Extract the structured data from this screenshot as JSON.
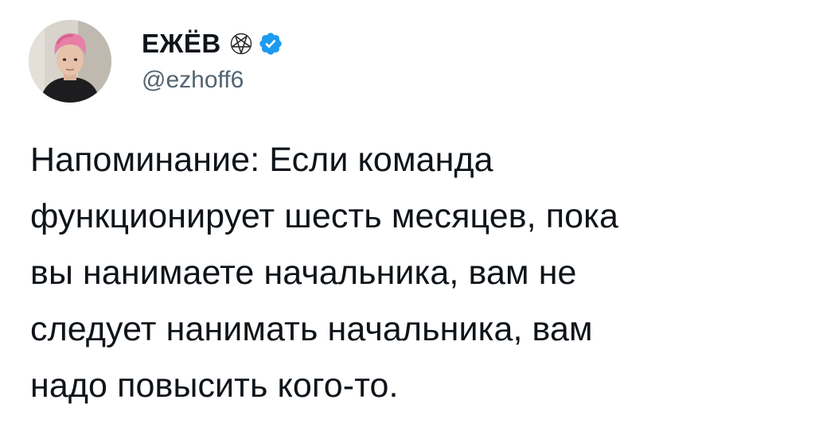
{
  "author": {
    "display_name": "ЕЖЁВ",
    "handle": "@ezhoff6",
    "badge_icon": "pentagram-icon",
    "verified_icon": "verified-badge-icon",
    "verified_color": "#1d9bf0",
    "avatar": "avatar-photo"
  },
  "tweet": {
    "text": "Напоминание: Если команда\nфункционирует шесть месяцев, пока\nвы нанимаете начальника, вам не\nследует нанимать начальника, вам\nнадо повысить кого-то."
  },
  "colors": {
    "text": "#0f1419",
    "secondary": "#536471",
    "background": "#ffffff"
  }
}
